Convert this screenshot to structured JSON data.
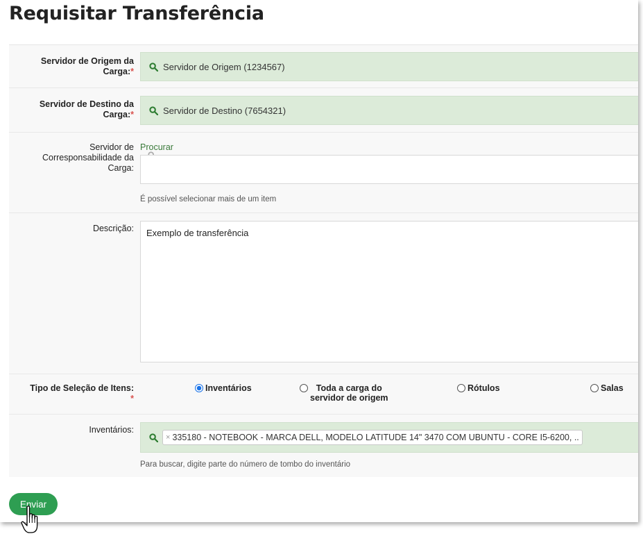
{
  "page": {
    "title": "Requisitar Transferência"
  },
  "form": {
    "origem": {
      "label_line1": "Servidor de Origem da",
      "label_line2": "Carga:",
      "required_mark": "*",
      "value": "Servidor de Origem (1234567)",
      "icon": "search-icon"
    },
    "destino": {
      "label_line1": "Servidor de Destino da",
      "label_line2": "Carga:",
      "required_mark": "*",
      "value": "Servidor de Destino (7654321)",
      "icon": "search-icon"
    },
    "corresponsabilidade": {
      "label_line1": "Servidor de",
      "label_line2": "Corresponsabilidade da",
      "label_line3": "Carga:",
      "link": "Procurar",
      "hint": "É possível selecionar mais de um item"
    },
    "descricao": {
      "label": "Descrição:",
      "value": "Exemplo de transferência"
    },
    "tipo_selecao": {
      "label": "Tipo de Seleção de Itens:",
      "required_mark": "*",
      "options": [
        {
          "label": "Inventários",
          "selected": true
        },
        {
          "label_line1": "Toda a carga do",
          "label_line2": "servidor de origem",
          "selected": false
        },
        {
          "label": "Rótulos",
          "selected": false
        },
        {
          "label": "Salas",
          "selected": false
        }
      ]
    },
    "inventarios": {
      "label": "Inventários:",
      "tag_remove": "×",
      "tag_value": "335180 - NOTEBOOK - MARCA DELL, MODELO LATITUDE 14\" 3470 COM UBUNTU - CORE I5-6200, ..",
      "hint": "Para buscar, digite parte do número de tombo do inventário"
    }
  },
  "submit": {
    "label": "Enviar"
  },
  "colors": {
    "field_green": "#dcebd9",
    "button_green": "#2e9e52",
    "link_green": "#3a7a3a",
    "required_red": "#d9534f"
  }
}
